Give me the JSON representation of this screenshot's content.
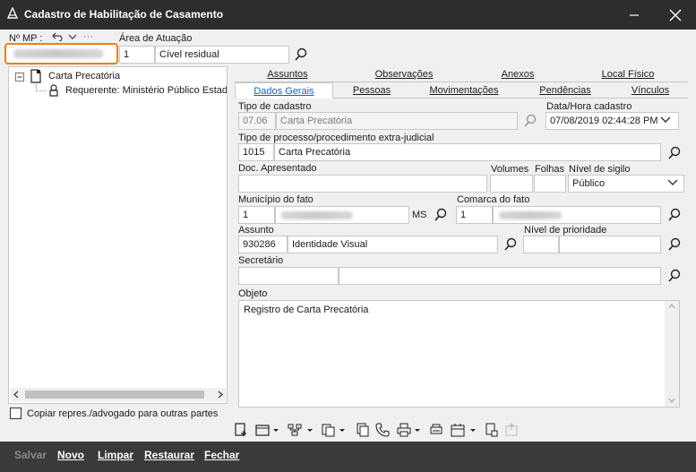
{
  "window": {
    "title": "Cadastro de Habilitação de Casamento"
  },
  "header": {
    "mp_label": "Nº MP :",
    "mp_more": "···",
    "area_label": "Área de Atuação",
    "area_code": "1",
    "area_name": "Cível residual"
  },
  "tree": {
    "root": "Carta Precatória",
    "child": "Requerente: Ministério Público Estad"
  },
  "copy_checkbox_label": "Copiar repres./advogado para outras partes",
  "tabs_top": [
    "Assuntos",
    "Observações",
    "Anexos",
    "Local Físico"
  ],
  "tabs_bottom": [
    "Dados Gerais",
    "Pessoas",
    "Movimentações",
    "Pendências",
    "Vínculos"
  ],
  "form": {
    "tipo_cadastro_label": "Tipo de cadastro",
    "tipo_cadastro_code": "07.06",
    "tipo_cadastro_name": "Carta Precatória",
    "data_hora_label": "Data/Hora cadastro",
    "data_hora_value": "07/08/2019 02:44:28 PM",
    "tipo_processo_label": "Tipo de processo/procedimento extra-judicial",
    "tipo_processo_code": "1015",
    "tipo_processo_name": "Carta Precatória",
    "doc_label": "Doc. Apresentado",
    "volumes_label": "Volumes",
    "folhas_label": "Folhas",
    "sigilo_label": "Nível de sigilo",
    "sigilo_value": "Público",
    "municipio_label": "Município do fato",
    "municipio_code": "1",
    "municipio_uf": "MS",
    "comarca_label": "Comarca do fato",
    "comarca_code": "1",
    "assunto_label": "Assunto",
    "assunto_code": "930286",
    "assunto_name": "Identidade Visual",
    "prioridade_label": "Nível de prioridade",
    "secretario_label": "Secretário",
    "objeto_label": "Objeto",
    "objeto_value": "Registro de Carta Precatória"
  },
  "footer": {
    "salvar": "Salvar",
    "novo": "Novo",
    "limpar": "Limpar",
    "restaurar": "Restaurar",
    "fechar": "Fechar"
  },
  "colors": {
    "titlebar": "#2d2d2d",
    "highlight": "#e8801a",
    "tab_active": "#1c5fb8"
  }
}
